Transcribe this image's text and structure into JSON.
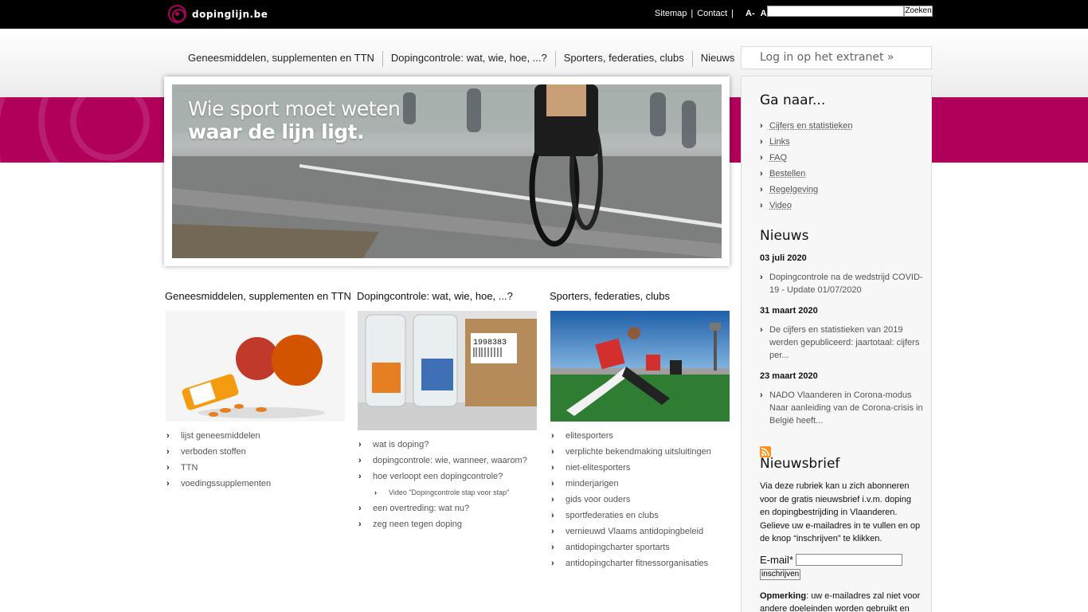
{
  "site": {
    "logo_text": "dopinglijn.be"
  },
  "toplinks": {
    "sitemap": "Sitemap",
    "contact": "Contact",
    "sep": "|",
    "font_smaller": "A-",
    "font_larger": "A+"
  },
  "search": {
    "button_label": "Zoeken",
    "value": ""
  },
  "nav": [
    "Geneesmiddelen, supplementen en TTN",
    "Dopingcontrole: wat, wie, hoe, ...?",
    "Sporters, federaties, clubs",
    "Nieuws"
  ],
  "hero": {
    "line1": "Wie sport moet weten",
    "line2": "waar de lijn ligt."
  },
  "columns": [
    {
      "title": "Geneesmiddelen, supplementen en TTN",
      "items": [
        "lijst geneesmiddelen",
        "verboden stoffen",
        "TTN",
        "voedingssupplementen"
      ]
    },
    {
      "title": "Dopingcontrole: wat, wie, hoe, ...?",
      "label_number": "1998383",
      "items": [
        "wat is doping?",
        "dopingcontrole: wie, wanneer, waarom?",
        "hoe verloopt een dopingcontrole?"
      ],
      "subitem": "Video \"Dopingcontrole stap voor stap\"",
      "items_after": [
        "een overtreding: wat nu?",
        "zeg neen tegen doping"
      ]
    },
    {
      "title": "Sporters, federaties, clubs",
      "items": [
        "elitesporters",
        "verplichte bekendmaking uitsluitingen",
        "niet-elitesporters",
        "minderjarigen",
        "gids voor ouders",
        "sportfederaties en clubs",
        "vernieuwd Vlaams antidopingbeleid",
        "antidopingcharter sportarts",
        "antidopingcharter fitnessorganisaties"
      ]
    }
  ],
  "sidebar": {
    "login": "Log in op het extranet »",
    "goto_title": "Ga naar...",
    "goto_items": [
      "Cijfers en statistieken",
      "Links",
      "FAQ",
      "Bestellen",
      "Regelgeving",
      "Video"
    ],
    "news_title": "Nieuws",
    "news": [
      {
        "date": "03 juli 2020",
        "text": "Dopingcontrole na de wedstrijd COVID-19 - Update 01/07/2020"
      },
      {
        "date": "31 maart 2020",
        "text": "De cijfers en statistieken van 2019 werden gepubliceerd: jaartotaal: cijfers per..."
      },
      {
        "date": "23 maart 2020",
        "text": "NADO Vlaanderen in Corona-modus Naar aanleiding van de Corona-crisis in België heeft..."
      }
    ],
    "newsletter_title": "Nieuwsbrief",
    "newsletter_text": "Via deze rubriek kan u zich abonneren voor de gratis nieuwsbrief i.v.m. doping en dopingbestrijding in Vlaanderen. Gelieve uw e-mailadres in te vullen en op de knop “inschrijven” te klikken.",
    "email_label": "E-mail*",
    "email_value": "",
    "subscribe_label": "inschrijven",
    "remark_bold": "Opmerking",
    "remark_text": ": uw e-mailadres zal niet voor andere doeleinden worden gebruikt en"
  },
  "chevron": "›",
  "colors": {
    "brand_pink": "#b0005a",
    "topbar": "#000000"
  }
}
